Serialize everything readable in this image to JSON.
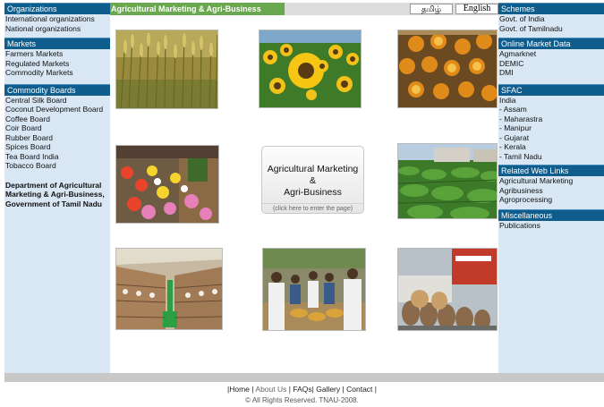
{
  "header": {
    "banner": "Agricultural Marketing & Agri-Business",
    "lang_tamil": "தமிழ்",
    "lang_english": "English"
  },
  "left": {
    "organizations": {
      "title": "Organizations",
      "items": [
        "International organizations",
        "National organizations"
      ]
    },
    "markets": {
      "title": "Markets",
      "items": [
        "Farmers Markets",
        "Regulated Markets",
        "Commodity Markets"
      ]
    },
    "commodity_boards": {
      "title": "Commodity Boards",
      "items": [
        "Central Silk Board",
        "Coconut Development Board",
        "Coffee Board",
        "Coir Board",
        "Rubber Board",
        "Spices Board",
        "Tea Board India",
        "Tobacco Board"
      ]
    },
    "department": [
      "Department of Agricultural",
      "Marketing & Agri-Business,",
      "Government of Tamil Nadu"
    ]
  },
  "right": {
    "schemes": {
      "title": "Schemes",
      "items": [
        "Govt. of India",
        "Govt. of Tamilnadu"
      ]
    },
    "online_market_data": {
      "title": "Online Market Data",
      "items": [
        "Agmarknet",
        "DEMIC",
        "DMI"
      ]
    },
    "sfac": {
      "title": "SFAC",
      "items": [
        "India",
        "- Assam",
        "- Maharastra",
        "- Manipur",
        "- Gujarat",
        "- Kerala",
        "- Tamil Nadu"
      ]
    },
    "related_links": {
      "title": "Related Web Links",
      "items": [
        "Agricultural Marketing",
        "Agribusiness",
        "Agroprocessing"
      ]
    },
    "misc": {
      "title": "Miscellaneous",
      "items": [
        "Publications"
      ]
    }
  },
  "center": {
    "line1": "Agricultural Marketing",
    "line2": "&",
    "line3": "Agri-Business",
    "hint": "(click here to enter the page)"
  },
  "footer": {
    "home": "Home",
    "about": "About Us",
    "faqs": "FAQs",
    "gallery": "Gallery",
    "contact": "Contact",
    "copyright": "© All Rights Reserved. TNAU-2008."
  },
  "colors": {
    "sidebar_bg": "#d9e7f5",
    "section_header": "#0f5d8c",
    "banner_green": "#6aa84f"
  }
}
